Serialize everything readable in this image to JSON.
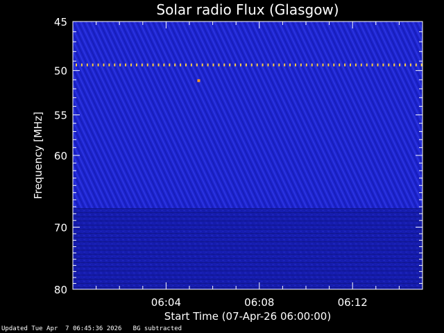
{
  "chart_data": {
    "type": "heatmap",
    "title": "Solar radio Flux (Glasgow)",
    "xlabel": "Start Time (07-Apr-26 06:00:00)",
    "ylabel": "Frequency [MHz]",
    "x_axis": {
      "unit": "minutes after 06:00:00",
      "range": [
        0,
        15
      ],
      "ticks": [
        4,
        8,
        12
      ],
      "tick_labels": [
        "06:04",
        "06:08",
        "06:12"
      ]
    },
    "y_axis": {
      "scale": "log",
      "unit": "MHz",
      "range": [
        45,
        80
      ],
      "ticks": [
        45,
        50,
        55,
        60,
        70,
        80
      ],
      "tick_labels": [
        "45",
        "50",
        "55",
        "60",
        "70",
        "80"
      ],
      "minor_ticks": [
        46,
        47,
        48,
        49,
        51,
        52,
        53,
        54,
        56,
        57,
        58,
        59,
        61,
        62,
        63,
        64,
        65,
        66,
        67,
        68,
        69,
        71,
        72,
        73,
        74,
        75,
        76,
        77,
        78,
        79
      ]
    },
    "background_color": "#1a22c8",
    "features": [
      {
        "name": "interference line",
        "frequency_mhz": 49.4,
        "x_range": [
          0,
          15
        ],
        "color": "#ffcc44"
      },
      {
        "name": "spot",
        "frequency_mhz": 51.1,
        "time_min": 5.4,
        "color": "#ff9922"
      }
    ]
  },
  "footer": {
    "updated": "Updated Tue Apr  7 06:45:36 2026",
    "note": "BG subtracted"
  }
}
